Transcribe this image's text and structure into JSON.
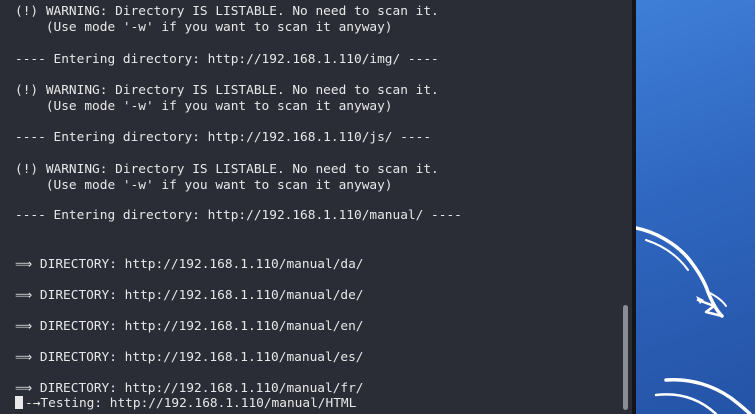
{
  "terminal": {
    "lines": [
      "(!) WARNING: Directory IS LISTABLE. No need to scan it.",
      "    (Use mode '-w' if you want to scan it anyway)",
      "---- Entering directory: http://192.168.1.110/img/ ----",
      "(!) WARNING: Directory IS LISTABLE. No need to scan it.",
      "    (Use mode '-w' if you want to scan it anyway)",
      "---- Entering directory: http://192.168.1.110/js/ ----",
      "(!) WARNING: Directory IS LISTABLE. No need to scan it.",
      "    (Use mode '-w' if you want to scan it anyway)",
      "---- Entering directory: http://192.168.1.110/manual/ ----"
    ],
    "arrow": "⟹",
    "directories": [
      "DIRECTORY: http://192.168.1.110/manual/da/",
      "DIRECTORY: http://192.168.1.110/manual/de/",
      "DIRECTORY: http://192.168.1.110/manual/en/",
      "DIRECTORY: http://192.168.1.110/manual/es/",
      "DIRECTORY: http://192.168.1.110/manual/fr/"
    ],
    "testing": "Testing: http://192.168.1.110/manual/HTML",
    "progress_glyph": "-→"
  },
  "colors": {
    "terminal_bg": "#2a2d36",
    "text": "#e8e8e8",
    "desktop_blue": "#2f67c0"
  },
  "icons": [
    "kali-dragon-icon",
    "cursor-icon"
  ]
}
